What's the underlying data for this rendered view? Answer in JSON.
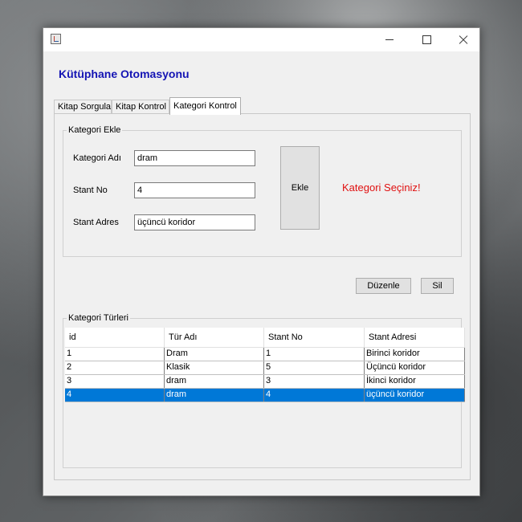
{
  "app": {
    "title": "Kütüphane Otomasyonu"
  },
  "tabs": [
    {
      "label": "Kitap Sorgula",
      "active": false
    },
    {
      "label": "Kitap Kontrol",
      "active": false
    },
    {
      "label": "Kategori Kontrol",
      "active": true
    }
  ],
  "form": {
    "legend": "Kategori Ekle",
    "fields": [
      {
        "label": "Kategori Adı",
        "value": "dram"
      },
      {
        "label": "Stant No",
        "value": "4"
      },
      {
        "label": "Stant Adres",
        "value": "üçüncü koridor"
      }
    ],
    "add_button": "Ekle",
    "message": "Kategori Seçiniz!"
  },
  "actions": {
    "edit_label": "Düzenle",
    "delete_label": "Sil"
  },
  "table": {
    "legend": "Kategori Türleri",
    "columns": [
      "id",
      "Tür Adı",
      "Stant No",
      "Stant Adresi"
    ],
    "rows": [
      [
        "1",
        "Dram",
        "1",
        "Birinci koridor"
      ],
      [
        "2",
        "Klasik",
        "5",
        "Üçüncü koridor"
      ],
      [
        "3",
        "dram",
        "3",
        "İkinci koridor"
      ],
      [
        "4",
        "dram",
        "4",
        "üçüncü koridor"
      ]
    ],
    "selected_row": 3
  },
  "colors": {
    "title": "#1414b4",
    "message": "#e01010",
    "selection": "#0078d7"
  },
  "icons": [
    "java-app-icon",
    "minimize-icon",
    "maximize-icon",
    "close-icon"
  ]
}
